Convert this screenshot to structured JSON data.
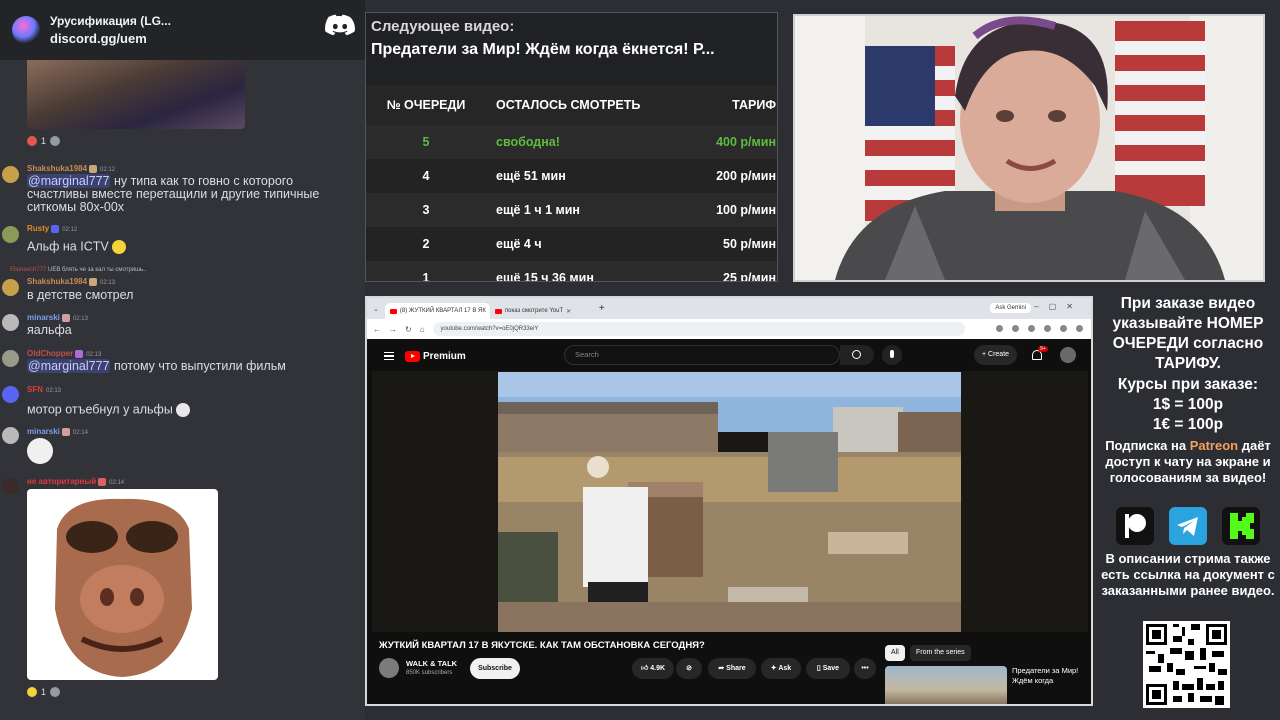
{
  "discord": {
    "server_name": "Урусификация (LG...",
    "invite": "discord.gg/uem",
    "messages": [
      {
        "user": "Shakshuka1984",
        "user_color": "#c98a54",
        "time": "02:12",
        "mention": "@marginal777",
        "text": " ну типа как то говно с которого счастливы вместе перетащили и другие типичные ситкомы 80х-00х"
      },
      {
        "user": "Rusty",
        "user_color": "#e08b2e",
        "time": "02:12",
        "text": "Альф на ICTV"
      },
      {
        "reply_user": "Eliuneech777",
        "reply_text": "UEB  блять че за кал ты смотришь..",
        "user": "Shakshuka1984",
        "user_color": "#c98a54",
        "time": "02:13",
        "text": "в детстве смотрел"
      },
      {
        "user": "minarski",
        "user_color": "#7c9ee8",
        "time": "02:13",
        "text": "яальфа"
      },
      {
        "user": "OldChopper",
        "user_color": "#c0504d",
        "time": "02:13",
        "mention": "@marginal777",
        "text": " потому что выпустили фильм"
      },
      {
        "user": "SFN",
        "user_color": "#e23a3a",
        "time": "02:13",
        "text": "мотор отъебнул у альфы"
      },
      {
        "user": "minarski",
        "user_color": "#7c9ee8",
        "time": "02:14",
        "text": ""
      },
      {
        "user": "не авторитарный",
        "user_color": "#e23a3a",
        "time": "02:14",
        "text": ""
      }
    ],
    "reactions": [
      {
        "count": "1"
      },
      {
        "count": "1"
      }
    ]
  },
  "queue": {
    "next_label": "Следующее видео:",
    "next_title": "Предатели за Мир! Ждём когда ёкнется! Р...",
    "headers": [
      "№ ОЧЕРЕДИ",
      "ОСТАЛОСЬ СМОТРЕТЬ",
      "ТАРИФ"
    ],
    "rows": [
      {
        "num": "5",
        "left": "свободна!",
        "rate": "400 р/мин"
      },
      {
        "num": "4",
        "left": "ещё 51 мин",
        "rate": "200 р/мин"
      },
      {
        "num": "3",
        "left": "ещё 1 ч 1 мин",
        "rate": "100 р/мин"
      },
      {
        "num": "2",
        "left": "ещё 4 ч",
        "rate": "50 р/мин"
      },
      {
        "num": "1",
        "left": "ещё 15 ч 36 мин",
        "rate": "25 р/мин"
      }
    ]
  },
  "browser": {
    "tabs": [
      {
        "label": "(8) ЖУТКИЙ КВАРТАЛ 17 В ЯК"
      },
      {
        "label": "показ смотрите  YouT"
      }
    ],
    "ask_gemini": "Ask Gemini",
    "url": "youtube.com/watch?v=oE0jQR33eiY",
    "yt": {
      "premium": "Premium",
      "search_placeholder": "Search",
      "create": "+ Create",
      "bell_badge": "9+",
      "video_title": "ЖУТКИЙ КВАРТАЛ 17 В ЯКУТСКЕ. КАК ТАМ ОБСТАНОВКА СЕГОДНЯ?",
      "channel": "WALK & TALK",
      "subs": "850K subscribers",
      "subscribe": "Subscribe",
      "likes": "4.9K",
      "share": "Share",
      "ask": "Ask",
      "save": "Save",
      "more": "•••",
      "chip_all": "All",
      "chip_series": "From the series",
      "rec_title": "Предатели за Мир! Ждём когда"
    }
  },
  "info": {
    "order_text": "При заказе видео указывайте НОМЕР ОЧЕРЕДИ согласно ТАРИФУ.",
    "rates_label": "Курсы при заказе:",
    "usd": "1$ = 100р",
    "eur": "1€ = 100р",
    "sub_prefix": "Подписка на ",
    "patreon": "Patreon",
    "sub_suffix": " даёт доступ к чату на экране и голосованиям за видео!",
    "desc_text": "В описании стрима также есть ссылка на документ с заказанными ранее видео."
  },
  "colors": {
    "free_green": "#5ebd3e",
    "patreon_orange": "#f0a25a",
    "youtube_red": "#ff0000",
    "telegram_blue": "#2aa3df",
    "kick_green": "#53fc18"
  }
}
